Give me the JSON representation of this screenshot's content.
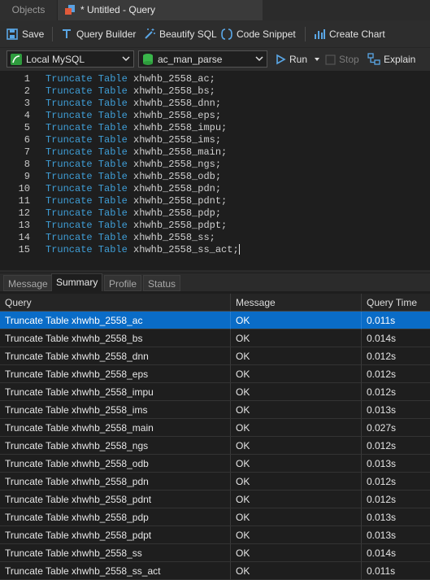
{
  "tabs": {
    "objects": "Objects",
    "query": "* Untitled - Query"
  },
  "toolbar": {
    "save": "Save",
    "query_builder": "Query Builder",
    "beautify": "Beautify SQL",
    "snippet": "Code Snippet",
    "create_chart": "Create Chart"
  },
  "connection": {
    "server": "Local MySQL",
    "database": "ac_man_parse",
    "run": "Run",
    "stop": "Stop",
    "explain": "Explain"
  },
  "editor": {
    "lines": [
      {
        "num": "1",
        "kw": "Truncate Table",
        "rest": " xhwhb_2558_ac;"
      },
      {
        "num": "2",
        "kw": "Truncate Table",
        "rest": " xhwhb_2558_bs;"
      },
      {
        "num": "3",
        "kw": "Truncate Table",
        "rest": " xhwhb_2558_dnn;"
      },
      {
        "num": "4",
        "kw": "Truncate Table",
        "rest": " xhwhb_2558_eps;"
      },
      {
        "num": "5",
        "kw": "Truncate Table",
        "rest": " xhwhb_2558_impu;"
      },
      {
        "num": "6",
        "kw": "Truncate Table",
        "rest": " xhwhb_2558_ims;"
      },
      {
        "num": "7",
        "kw": "Truncate Table",
        "rest": " xhwhb_2558_main;"
      },
      {
        "num": "8",
        "kw": "Truncate Table",
        "rest": " xhwhb_2558_ngs;"
      },
      {
        "num": "9",
        "kw": "Truncate Table",
        "rest": " xhwhb_2558_odb;"
      },
      {
        "num": "10",
        "kw": "Truncate Table",
        "rest": " xhwhb_2558_pdn;"
      },
      {
        "num": "11",
        "kw": "Truncate Table",
        "rest": " xhwhb_2558_pdnt;"
      },
      {
        "num": "12",
        "kw": "Truncate Table",
        "rest": " xhwhb_2558_pdp;"
      },
      {
        "num": "13",
        "kw": "Truncate Table",
        "rest": " xhwhb_2558_pdpt;"
      },
      {
        "num": "14",
        "kw": "Truncate Table",
        "rest": " xhwhb_2558_ss;"
      },
      {
        "num": "15",
        "kw": "Truncate Table",
        "rest": " xhwhb_2558_ss_act;"
      }
    ]
  },
  "result_tabs": [
    "Message",
    "Summary",
    "Profile",
    "Status"
  ],
  "grid": {
    "columns": [
      "Query",
      "Message",
      "Query Time"
    ],
    "rows": [
      {
        "q": "Truncate Table xhwhb_2558_ac",
        "m": "OK",
        "t": "0.011s"
      },
      {
        "q": "Truncate Table xhwhb_2558_bs",
        "m": "OK",
        "t": "0.014s"
      },
      {
        "q": "Truncate Table xhwhb_2558_dnn",
        "m": "OK",
        "t": "0.012s"
      },
      {
        "q": "Truncate Table xhwhb_2558_eps",
        "m": "OK",
        "t": "0.012s"
      },
      {
        "q": "Truncate Table xhwhb_2558_impu",
        "m": "OK",
        "t": "0.012s"
      },
      {
        "q": "Truncate Table xhwhb_2558_ims",
        "m": "OK",
        "t": "0.013s"
      },
      {
        "q": "Truncate Table xhwhb_2558_main",
        "m": "OK",
        "t": "0.027s"
      },
      {
        "q": "Truncate Table xhwhb_2558_ngs",
        "m": "OK",
        "t": "0.012s"
      },
      {
        "q": "Truncate Table xhwhb_2558_odb",
        "m": "OK",
        "t": "0.013s"
      },
      {
        "q": "Truncate Table xhwhb_2558_pdn",
        "m": "OK",
        "t": "0.012s"
      },
      {
        "q": "Truncate Table xhwhb_2558_pdnt",
        "m": "OK",
        "t": "0.012s"
      },
      {
        "q": "Truncate Table xhwhb_2558_pdp",
        "m": "OK",
        "t": "0.013s"
      },
      {
        "q": "Truncate Table xhwhb_2558_pdpt",
        "m": "OK",
        "t": "0.013s"
      },
      {
        "q": "Truncate Table xhwhb_2558_ss",
        "m": "OK",
        "t": "0.014s"
      },
      {
        "q": "Truncate Table xhwhb_2558_ss_act",
        "m": "OK",
        "t": "0.011s"
      }
    ]
  }
}
